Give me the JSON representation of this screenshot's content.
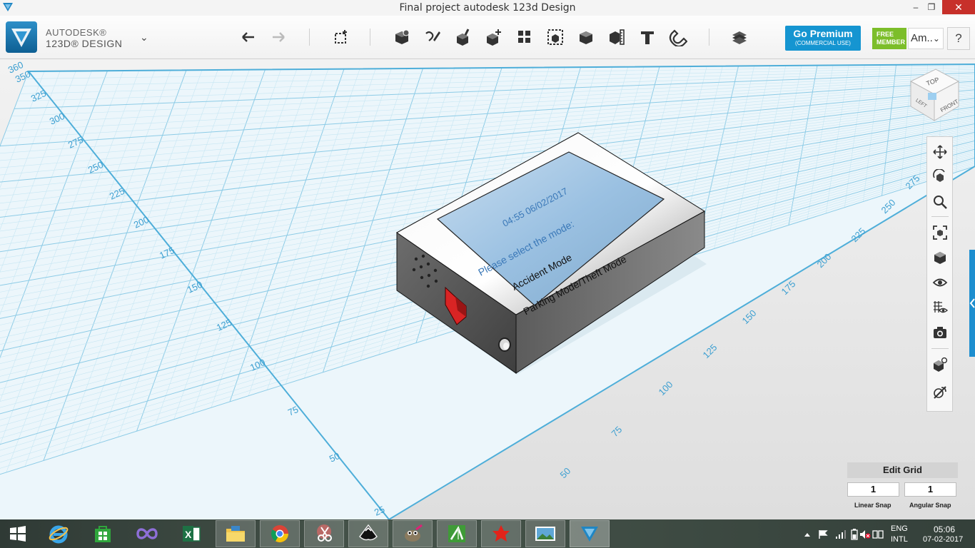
{
  "window": {
    "title": "Final project autodesk 123d Design",
    "minimize_glyph": "–",
    "maximize_glyph": "❐",
    "close_glyph": "✕"
  },
  "brand": {
    "line1": "AUTODESK®",
    "line2": "123D® DESIGN",
    "menu_glyph": "⌄",
    "color": "#1a78b4"
  },
  "toolbar": {
    "undo_icon": "undo-icon",
    "redo_icon": "redo-icon",
    "tools": [
      "transform",
      "primitives",
      "sketch",
      "construct",
      "modify",
      "pattern",
      "grouping",
      "combine",
      "measure",
      "text",
      "snap",
      "material"
    ]
  },
  "account": {
    "premium_label": "Go Premium",
    "premium_sub": "(COMMERCIAL USE)",
    "premium_color": "#1595d1",
    "free_line1": "FREE",
    "free_line2": "MEMBER",
    "free_color": "#7cbe2a",
    "user_name": "Am..",
    "user_chevron": "⌄",
    "help_label": "?"
  },
  "viewcube": {
    "top": "TOP",
    "left": "LEFT",
    "front": "FRONT"
  },
  "grid_labels_left": [
    "360",
    "350",
    "325",
    "300",
    "275",
    "250",
    "225",
    "200",
    "175",
    "150",
    "125",
    "100",
    "75",
    "50",
    "25"
  ],
  "grid_labels_right": [
    "275",
    "250",
    "225",
    "200",
    "175",
    "150",
    "125",
    "100",
    "75",
    "50"
  ],
  "model_screen": {
    "datetime": "04:55 06/02/2017",
    "prompt": "Please select the mode:",
    "option1": "Accident Mode",
    "option2": "Parking Mode/Theft Mode"
  },
  "nav_tools": [
    "pan-icon",
    "orbit-icon",
    "zoom-icon",
    "fit-icon",
    "views-icon",
    "visibility-icon",
    "grid-icon",
    "camera-icon",
    "materials-icon",
    "render-icon"
  ],
  "grid_panel": {
    "title": "Edit Grid",
    "linear_snap_value": "1",
    "angular_snap_value": "1",
    "linear_label": "Linear Snap",
    "angular_label": "Angular Snap"
  },
  "taskbar": {
    "lang1": "ENG",
    "lang2": "INTL",
    "time": "05:06",
    "date": "07-02-2017"
  }
}
